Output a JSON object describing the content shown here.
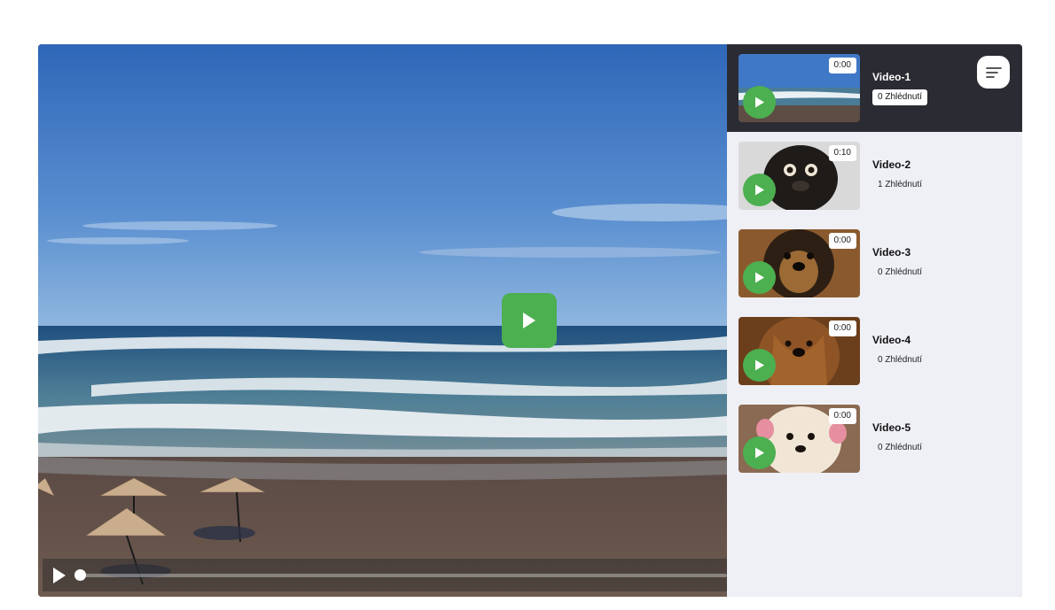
{
  "main_player": {
    "big_play_icon": "play-icon",
    "controls": {
      "play_icon": "play-icon",
      "progress": 0.0
    }
  },
  "playlist": {
    "sort_icon": "sort-icon",
    "items": [
      {
        "title": "Video-1",
        "duration": "0:00",
        "views": "0 Zhlédnutí",
        "active": true
      },
      {
        "title": "Video-2",
        "duration": "0:10",
        "views": "1 Zhlédnutí",
        "active": false
      },
      {
        "title": "Video-3",
        "duration": "0:00",
        "views": "0 Zhlédnutí",
        "active": false
      },
      {
        "title": "Video-4",
        "duration": "0:00",
        "views": "0 Zhlédnutí",
        "active": false
      },
      {
        "title": "Video-5",
        "duration": "0:00",
        "views": "0 Zhlédnutí",
        "active": false
      }
    ]
  },
  "colors": {
    "accent_green": "#4caf50",
    "active_item_bg": "#2b2b33",
    "sidebar_bg": "#eff0f6"
  }
}
